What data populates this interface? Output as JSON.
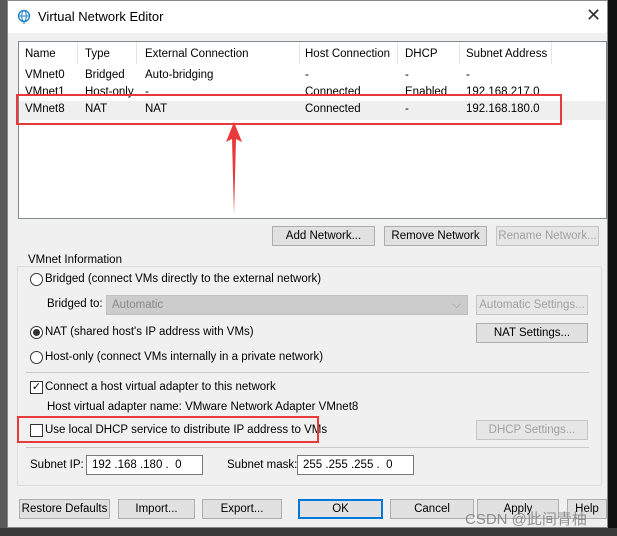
{
  "window": {
    "title": "Virtual Network Editor",
    "icon": "globe-network-icon"
  },
  "table": {
    "columns": [
      "Name",
      "Type",
      "External Connection",
      "Host Connection",
      "DHCP",
      "Subnet Address"
    ],
    "rows": [
      [
        "VMnet0",
        "Bridged",
        "Auto-bridging",
        "-",
        "-",
        "-"
      ],
      [
        "VMnet1",
        "Host-only",
        "-",
        "Connected",
        "Enabled",
        "192.168.217.0"
      ],
      [
        "VMnet8",
        "NAT",
        "NAT",
        "Connected",
        "-",
        "192.168.180.0"
      ]
    ],
    "selected_row": 2
  },
  "list_buttons": {
    "add": "Add Network...",
    "remove": "Remove Network",
    "rename": "Rename Network..."
  },
  "info": {
    "group_label": "VMnet Information",
    "bridged_label": "Bridged (connect VMs directly to the external network)",
    "bridged_to_label": "Bridged to:",
    "bridged_to_value": "Automatic",
    "auto_settings": "Automatic Settings...",
    "nat_label": "NAT (shared host's IP address with VMs)",
    "nat_settings": "NAT Settings...",
    "hostonly_label": "Host-only (connect VMs internally in a private network)",
    "selected_mode": "nat",
    "connect_adapter_label": "Connect a host virtual adapter to this network",
    "connect_adapter_checked": true,
    "adapter_name": "Host virtual adapter name: VMware Network Adapter VMnet8",
    "dhcp_label": "Use local DHCP service to distribute IP address to VMs",
    "dhcp_checked": false,
    "dhcp_settings": "DHCP Settings...",
    "subnet_ip_label": "Subnet IP:",
    "subnet_ip": "192 .168 .180 .  0",
    "subnet_mask_label": "Subnet mask:",
    "subnet_mask": "255 .255 .255 .  0"
  },
  "footer": {
    "restore": "Restore Defaults",
    "import": "Import...",
    "export": "Export...",
    "ok": "OK",
    "cancel": "Cancel",
    "apply": "Apply",
    "help": "Help"
  },
  "watermark": "CSDN @此间青柚",
  "colors": {
    "highlight": "#e83a3a",
    "ok_border": "#0078d7"
  }
}
